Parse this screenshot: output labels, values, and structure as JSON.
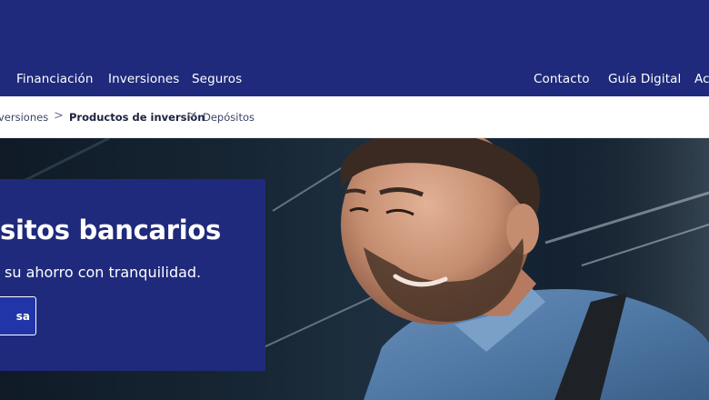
{
  "nav": {
    "items": [
      "Financiación",
      "Inversiones",
      "Seguros"
    ],
    "right_items": [
      "Contacto",
      "Guía Digital",
      "Ac"
    ]
  },
  "breadcrumb": {
    "items": [
      "versiones",
      "Productos de inversión",
      "Depósitos"
    ],
    "separator": ">"
  },
  "hero": {
    "title": "sitos bancarios",
    "subtitle": "su ahorro con tranquilidad.",
    "button_label": "sa"
  },
  "colors": {
    "brand_navy": "#1f2a7c",
    "button_blue": "#2235a8"
  },
  "icons": [
    "chevron-right-icon"
  ]
}
